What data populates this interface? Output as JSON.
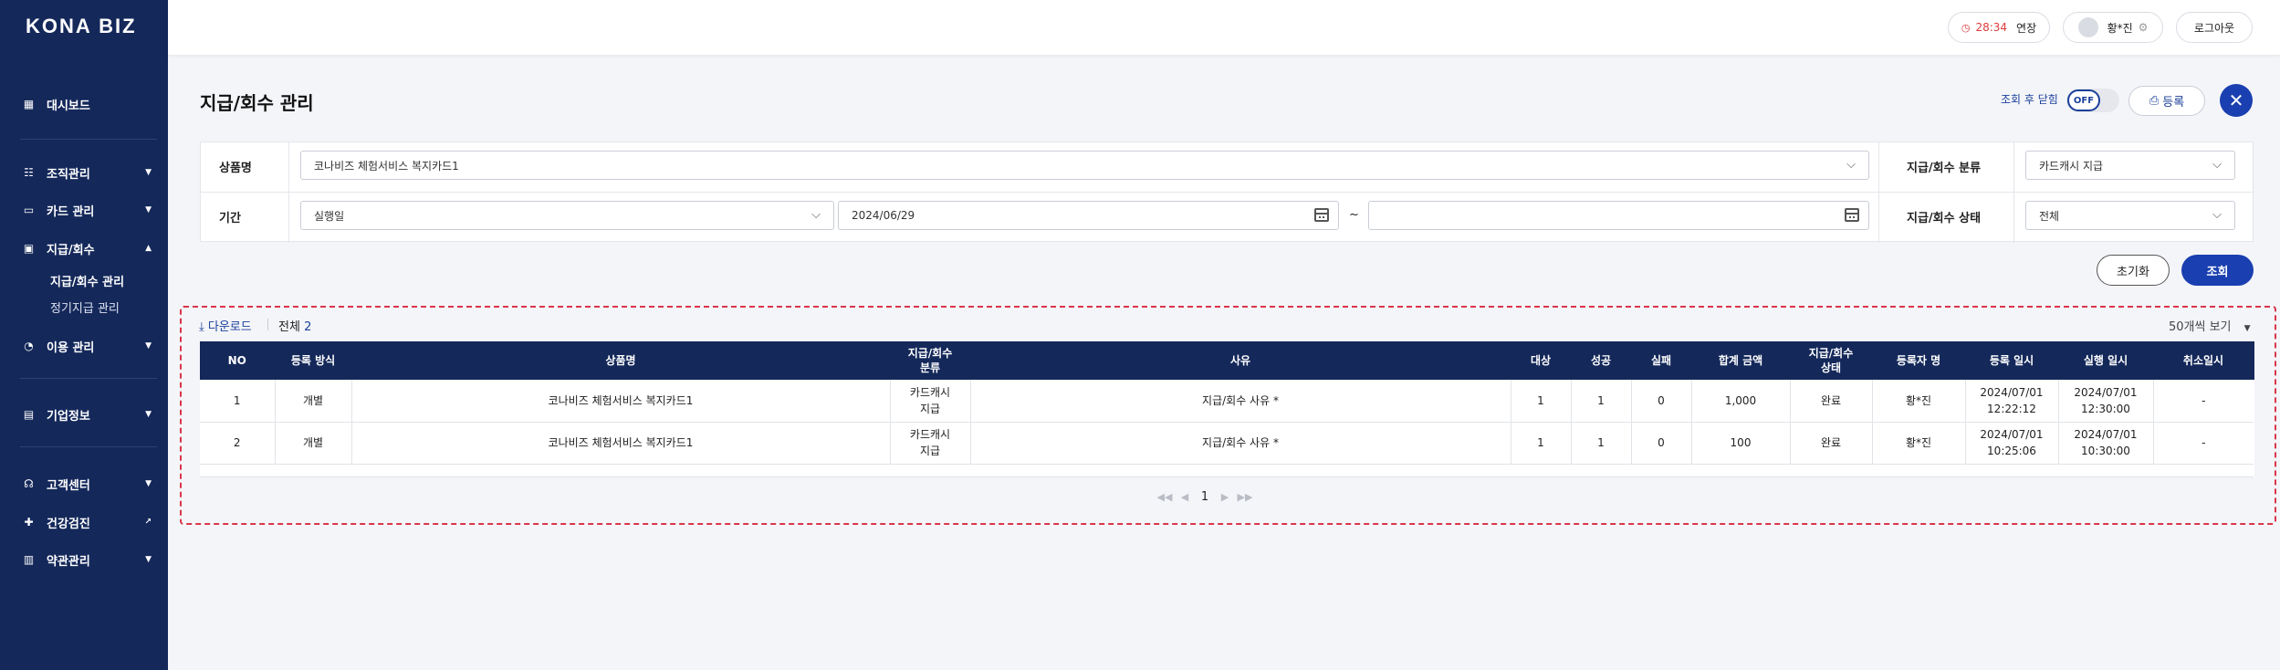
{
  "brand": "KONA BIZ",
  "sidebar": {
    "items": [
      {
        "label": "대시보드",
        "icon": "dashboard-icon"
      },
      {
        "label": "조직관리",
        "icon": "organization-icon"
      },
      {
        "label": "카드 관리",
        "icon": "card-icon"
      },
      {
        "label": "지급/회수",
        "icon": "payment-icon"
      },
      {
        "label": "이용 관리",
        "icon": "usage-icon"
      },
      {
        "label": "기업정보",
        "icon": "company-icon"
      },
      {
        "label": "고객센터",
        "icon": "headset-icon"
      },
      {
        "label": "건강검진",
        "icon": "health-icon"
      },
      {
        "label": "약관관리",
        "icon": "terms-icon"
      }
    ],
    "sub_items": [
      {
        "label": "지급/회수 관리",
        "active": true
      },
      {
        "label": "정기지급 관리",
        "active": false
      }
    ]
  },
  "topbar": {
    "timer": "28:34",
    "extend_label": "연장",
    "user_name": "황*진",
    "logout_label": "로그아웃"
  },
  "page": {
    "title": "지급/회수 관리",
    "after_close_label": "조회 후 닫힘",
    "toggle_state": "OFF",
    "register_label": "등록"
  },
  "filters": {
    "product_label": "상품명",
    "product_value": "코나비즈 체험서비스 복지카드1",
    "period_label": "기간",
    "period_type": "실행일",
    "start_date": "2024/06/29",
    "end_date": "",
    "range_sep": "~",
    "category_label": "지급/회수 분류",
    "category_value": "카드캐시 지급",
    "status_label": "지급/회수 상태",
    "status_value": "전체",
    "reset_label": "초기화",
    "search_label": "조회"
  },
  "results": {
    "download_label": "다운로드",
    "total_label": "전체",
    "total_count": "2",
    "per_page_label": "50개씩 보기",
    "columns": [
      "NO",
      "등록 방식",
      "상품명",
      "지급/회수\n분류",
      "사유",
      "대상",
      "성공",
      "실패",
      "합계 금액",
      "지급/회수\n상태",
      "등록자 명",
      "등록 일시",
      "실행 일시",
      "취소일시"
    ],
    "rows": [
      [
        "1",
        "개별",
        "코나비즈 체험서비스 복지카드1",
        "카드캐시\n지급",
        "지급/회수 사유 *",
        "1",
        "1",
        "0",
        "1,000",
        "완료",
        "황*진",
        "2024/07/01\n12:22:12",
        "2024/07/01\n12:30:00",
        "-"
      ],
      [
        "2",
        "개별",
        "코나비즈 체험서비스 복지카드1",
        "카드캐시\n지급",
        "지급/회수 사유 *",
        "1",
        "1",
        "0",
        "100",
        "완료",
        "황*진",
        "2024/07/01\n10:25:06",
        "2024/07/01\n10:30:00",
        "-"
      ]
    ],
    "current_page": "1"
  },
  "colors": {
    "navy": "#14285a",
    "accent": "#1a3fb0",
    "highlight": "#d9364a",
    "timer": "#e03a3a"
  }
}
